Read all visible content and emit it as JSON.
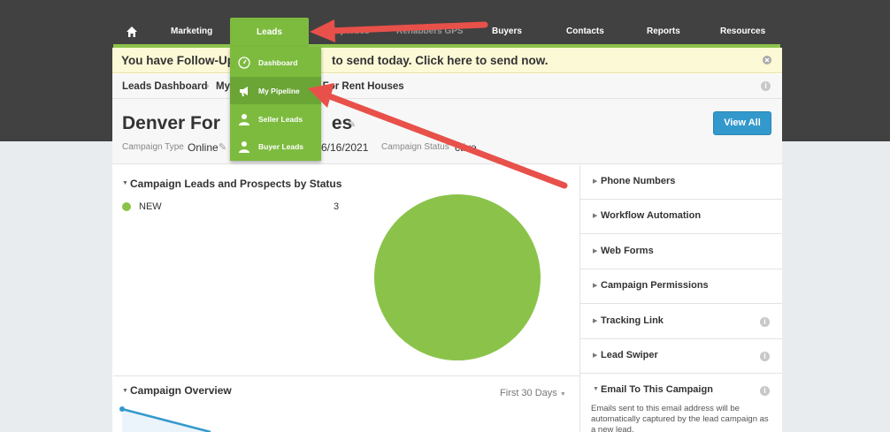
{
  "nav": {
    "items": [
      "Marketing",
      "Properties",
      "Rehabbers GPS",
      "Buyers",
      "Contacts",
      "Reports",
      "Resources"
    ],
    "active": "Leads"
  },
  "dropdown": {
    "items": [
      "Dashboard",
      "My Pipeline",
      "Seller Leads",
      "Buyer Leads"
    ]
  },
  "followup": {
    "text": "You have Follow-Up",
    "text_rest": "to send today. Click here to send now."
  },
  "breadcrumb": {
    "first": "Leads Dashboard",
    "second": "My",
    "third": "r For Rent Houses"
  },
  "campaign": {
    "title_start": "Denver For",
    "title_end": "es",
    "type_label": "Campaign Type",
    "type_value": "Online",
    "date_value": "6/16/2021",
    "status_label": "Campaign Status",
    "status_value": "ctive",
    "view_all": "View All"
  },
  "leads_status": {
    "title": "Campaign Leads and Prospects by Status",
    "legend": [
      {
        "name": "NEW",
        "value": "3"
      }
    ]
  },
  "chart_data": {
    "type": "pie",
    "categories": [
      "NEW"
    ],
    "values": [
      3
    ],
    "colors": [
      "#8bc34a"
    ]
  },
  "overview": {
    "title": "Campaign Overview",
    "range": "First 30 Days"
  },
  "sidebar": {
    "items": [
      "Phone Numbers",
      "Workflow Automation",
      "Web Forms",
      "Campaign Permissions",
      "Tracking Link",
      "Lead Swiper",
      "Email To This Campaign"
    ],
    "email_desc": "Emails sent to this email address will be automatically captured by the lead campaign as a new lead."
  },
  "colors": {
    "accent_green": "#7dbb3f",
    "button_blue": "#3399cc",
    "arrow_red": "#e8504a"
  }
}
